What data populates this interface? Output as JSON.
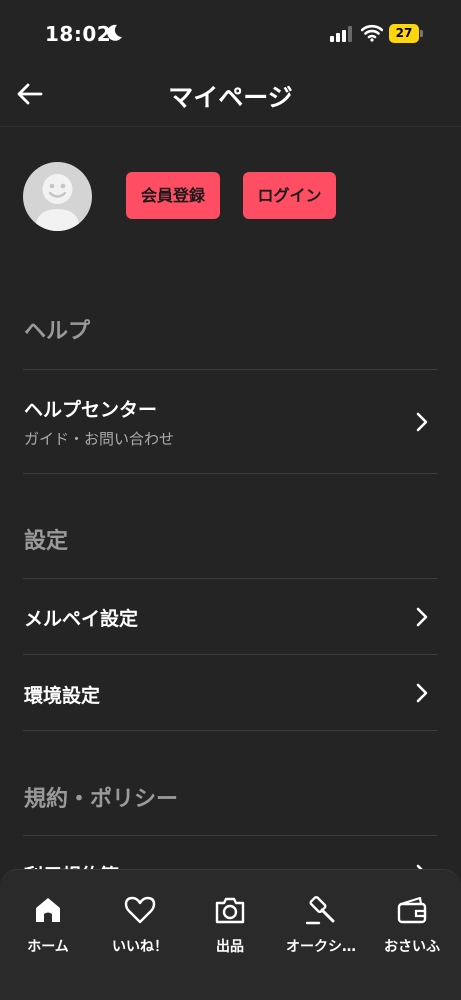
{
  "status_bar": {
    "time": "18:02",
    "battery": "27"
  },
  "nav": {
    "title": "マイページ"
  },
  "profile": {
    "register_label": "会員登録",
    "login_label": "ログイン"
  },
  "help": {
    "section_title": "ヘルプ",
    "help_center": {
      "title": "ヘルプセンター",
      "subtitle": "ガイド・お問い合わせ"
    }
  },
  "settings": {
    "section_title": "設定",
    "items": [
      {
        "label": "メルペイ設定"
      },
      {
        "label": "環境設定"
      }
    ]
  },
  "policy": {
    "section_title": "規約・ポリシー",
    "items": [
      {
        "label": "利用規約等"
      }
    ]
  },
  "tabbar": {
    "items": [
      {
        "label": "ホーム",
        "icon": "home-icon"
      },
      {
        "label": "いいね！",
        "icon": "heart-icon"
      },
      {
        "label": "出品",
        "icon": "camera-icon"
      },
      {
        "label": "オークシ…",
        "icon": "gavel-icon"
      },
      {
        "label": "おさいふ",
        "icon": "wallet-icon"
      }
    ]
  }
}
